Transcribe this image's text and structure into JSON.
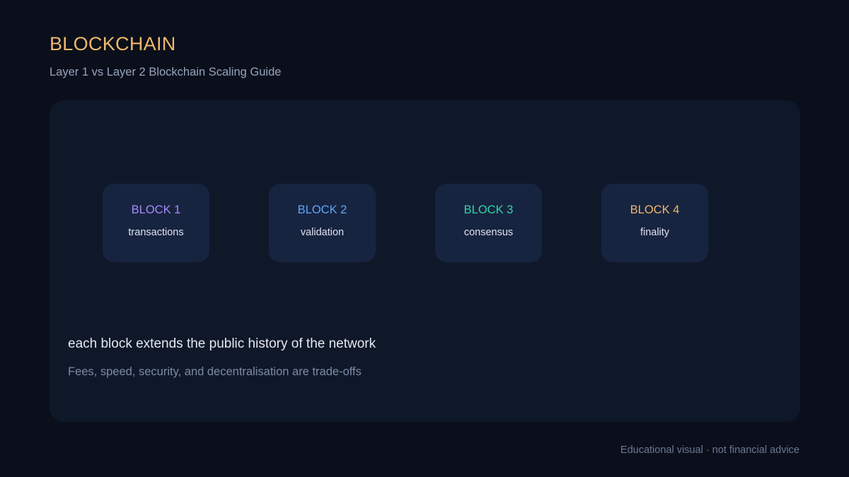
{
  "header": {
    "title": "BLOCKCHAIN",
    "subtitle": "Layer 1 vs Layer 2 Blockchain Scaling Guide"
  },
  "blocks": [
    {
      "title": "BLOCK 1",
      "subtitle": "transactions",
      "color": "#a78bfa"
    },
    {
      "title": "BLOCK 2",
      "subtitle": "validation",
      "color": "#60a5fa"
    },
    {
      "title": "BLOCK 3",
      "subtitle": "consensus",
      "color": "#34d3a8"
    },
    {
      "title": "BLOCK 4",
      "subtitle": "finality",
      "color": "#f0b86a"
    }
  ],
  "captions": {
    "main": "each block extends the public history of the network",
    "sub": "Fees, speed, security, and decentralisation are trade-offs"
  },
  "footer": {
    "note": "Educational visual · not financial advice"
  },
  "colors": {
    "background": "#0a0f1b",
    "panel": "#0f1829",
    "block": "#172440",
    "title_accent": "#f0b86a"
  }
}
